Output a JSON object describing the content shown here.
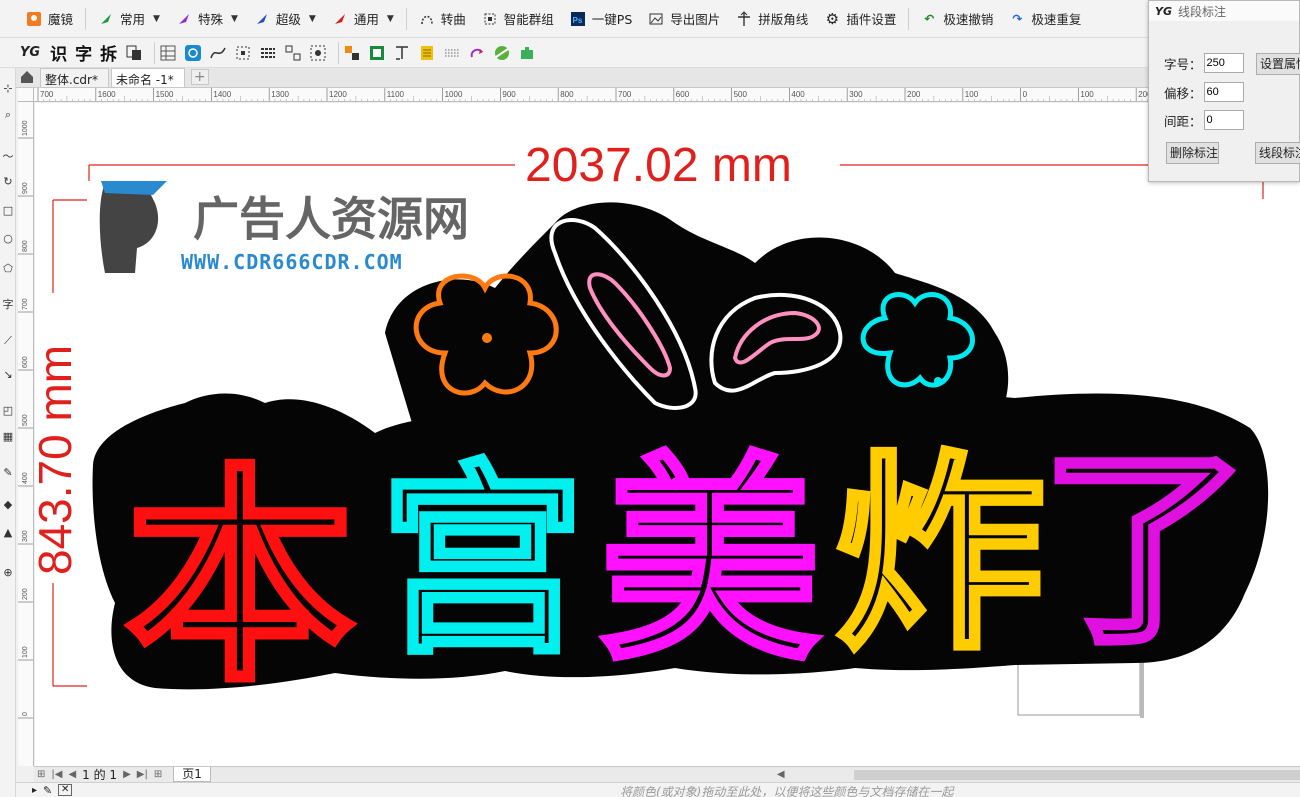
{
  "toolbar": {
    "items": [
      {
        "label": "魔镜",
        "icon": "mirror-icon",
        "dropdown": false
      },
      {
        "label": "常用",
        "icon": "green-arrow-icon",
        "dropdown": true
      },
      {
        "label": "特殊",
        "icon": "purple-arrow-icon",
        "dropdown": true
      },
      {
        "label": "超级",
        "icon": "blue-arrow-icon",
        "dropdown": true
      },
      {
        "label": "通用",
        "icon": "red-arrow-icon",
        "dropdown": true
      },
      {
        "label": "转曲",
        "icon": "curve-icon",
        "dropdown": false
      },
      {
        "label": "智能群组",
        "icon": "group-icon",
        "dropdown": false
      },
      {
        "label": "一键PS",
        "icon": "ps-icon",
        "dropdown": false
      },
      {
        "label": "导出图片",
        "icon": "image-icon",
        "dropdown": false
      },
      {
        "label": "拼版角线",
        "icon": "corner-line-icon",
        "dropdown": false
      },
      {
        "label": "插件设置",
        "icon": "gear-icon",
        "dropdown": false
      },
      {
        "label": "极速撤销",
        "icon": "undo-icon",
        "dropdown": false
      },
      {
        "label": "极速重复",
        "icon": "redo-icon",
        "dropdown": false
      }
    ]
  },
  "toolbar2": {
    "logo": "YG",
    "chars": [
      "识",
      "字",
      "拆"
    ]
  },
  "tabs": [
    {
      "label": "整体.cdr*",
      "active": false
    },
    {
      "label": "未命名 -1*",
      "active": true
    }
  ],
  "ruler_h_labels": [
    "700",
    "1600",
    "1500",
    "1400",
    "1300",
    "1200",
    "1100",
    "1000",
    "900",
    "800",
    "700",
    "600",
    "500",
    "400",
    "300",
    "200",
    "100",
    "0",
    "100",
    "200"
  ],
  "ruler_v_labels": [
    "1000",
    "900",
    "800",
    "700",
    "600",
    "500",
    "400",
    "300",
    "200",
    "100",
    "0"
  ],
  "design": {
    "width_dim": "2037.02 mm",
    "height_dim": "843.70 mm",
    "watermark_title": "广告人资源网",
    "watermark_url": "WWW.CDR666CDR.COM",
    "chars": [
      {
        "text": "本",
        "color": "#ff1010"
      },
      {
        "text": "宫",
        "color": "#00f0f0"
      },
      {
        "text": "美",
        "color": "#ff10ff"
      },
      {
        "text": "炸",
        "color": "#ffcc00"
      },
      {
        "text": "了",
        "color": "#e010e0"
      }
    ]
  },
  "panel": {
    "logo": "YG",
    "title": "线段标注",
    "font_size_label": "字号：",
    "font_size_value": "250",
    "offset_label": "偏移：",
    "offset_value": "60",
    "spacing_label": "间距：",
    "spacing_value": "0",
    "set_props_btn": "设置属性",
    "delete_btn": "删除标注",
    "segment_btn": "线段标注"
  },
  "pagebar": {
    "page_of": "1 的 1",
    "page_tab": "页1"
  },
  "status": {
    "hint": "将颜色(或对象)拖动至此处，以便将这些颜色与文档存储在一起"
  },
  "colors": {
    "dim_red": "#e0201c",
    "orange": "#ff7a10",
    "white": "#ffffff",
    "pink": "#ff90c0",
    "cyan": "#00e8f0"
  }
}
